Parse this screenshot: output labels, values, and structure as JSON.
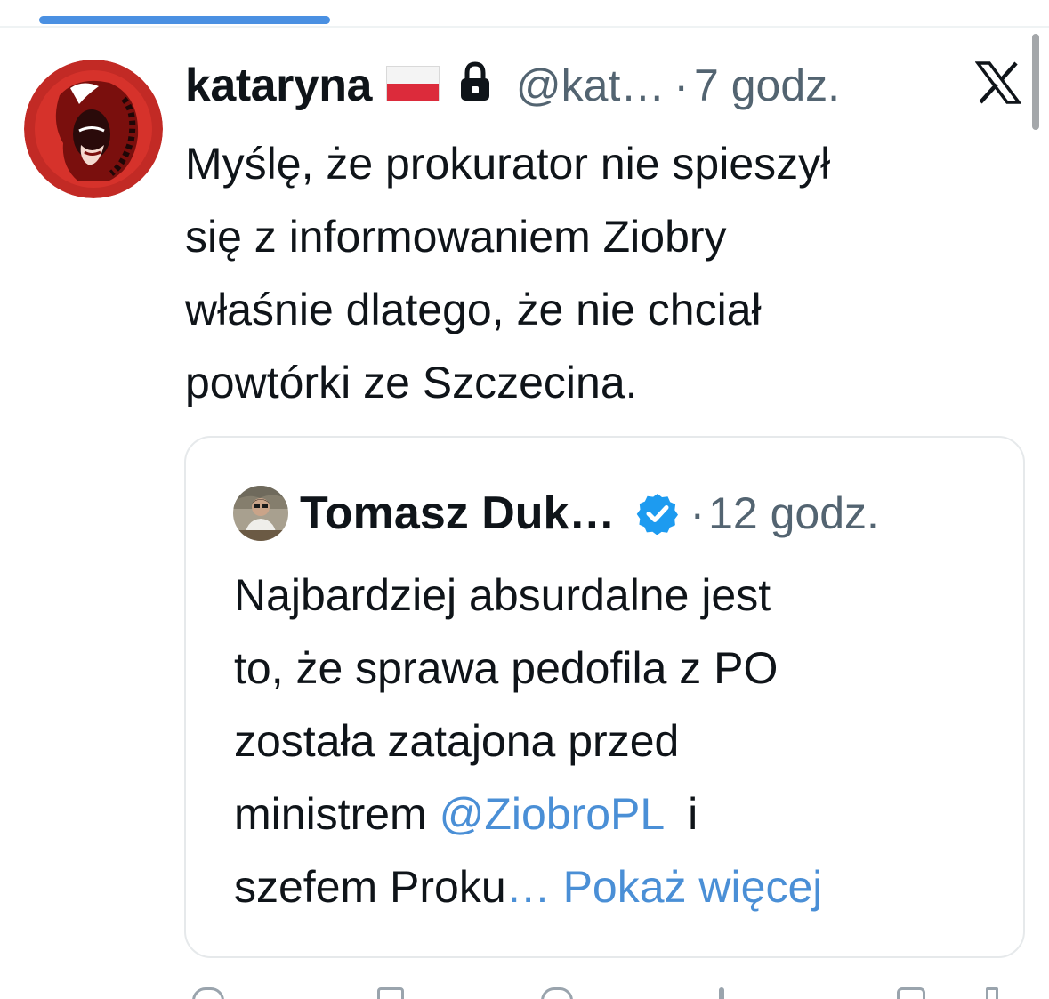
{
  "tweet": {
    "author_name": "kataryna",
    "handle": "@kat…",
    "separator": "·",
    "time": "7 godz.",
    "text_lines": [
      "Myślę, że prokurator nie spieszył",
      "się z informowaniem Ziobry",
      "właśnie dlatego, że nie chciał",
      "powtórki ze Szczecina."
    ]
  },
  "quoted": {
    "author_name": "Tomasz Duk…",
    "separator": "·",
    "time": "12 godz.",
    "line1": "Najbardziej absurdalne jest",
    "line2": "to, że sprawa pedofila z PO",
    "line3": "została zatajona przed",
    "line4_before": "ministrem ",
    "mention": "@ZiobroPL",
    "line4_after": "  i",
    "line5_before": "szefem Proku",
    "ellipsis": "…",
    "show_more": " Pokaż więcej"
  },
  "icons": {
    "flag": "poland-flag-icon",
    "lock": "lock-icon",
    "platform": "x-logo-icon",
    "verified": "verified-badge-icon"
  },
  "colors": {
    "text": "#0f1419",
    "secondary": "#536471",
    "link": "#4a8fd6",
    "verified": "#1d9bf0",
    "tab_indicator": "#4a90e2"
  }
}
